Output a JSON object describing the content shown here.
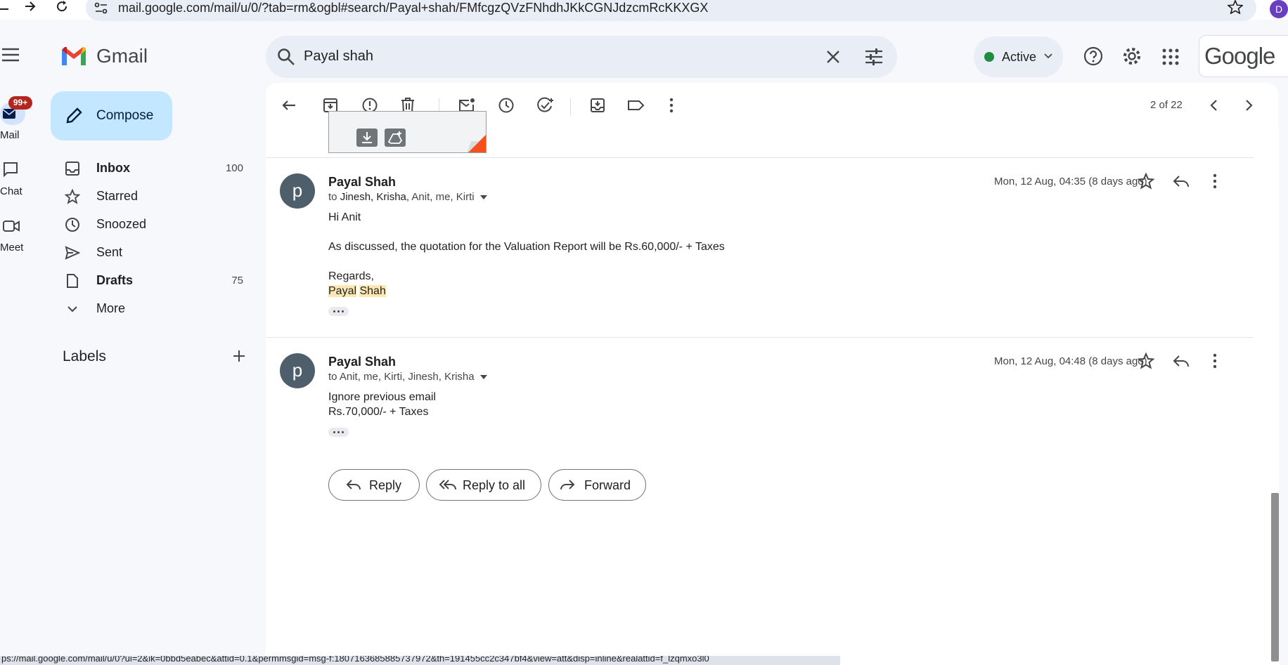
{
  "browser": {
    "url": "mail.google.com/mail/u/0/?tab=rm&ogbl#search/Payal+shah/FMfcgzQVzFNhdhJKkCGNJdzcmRcKKXGX",
    "profile_initial": "D",
    "status_url": "ps://mail.google.com/mail/u/0?ui=2&ik=0bbd5eabec&attid=0.1&permmsgid=msg-f:1807163685885737972&th=191455cc2c347bf4&view=att&disp=inline&realattid=f_lzqmxo3l0"
  },
  "rail": {
    "mail_label": "Mail",
    "mail_badge": "99+",
    "chat_label": "Chat",
    "meet_label": "Meet"
  },
  "app": {
    "name": "Gmail",
    "compose_label": "Compose",
    "labels_heading": "Labels",
    "brand_colors": {
      "red": "#ea4335",
      "blue": "#4285f4",
      "green": "#34a853",
      "yellow": "#fbbc04"
    }
  },
  "nav": [
    {
      "label": "Inbox",
      "count": "100",
      "icon": "inbox-icon",
      "bold": true
    },
    {
      "label": "Starred",
      "count": "",
      "icon": "star-icon",
      "bold": false
    },
    {
      "label": "Snoozed",
      "count": "",
      "icon": "clock-icon",
      "bold": false
    },
    {
      "label": "Sent",
      "count": "",
      "icon": "send-icon",
      "bold": false
    },
    {
      "label": "Drafts",
      "count": "75",
      "icon": "draft-icon",
      "bold": true
    },
    {
      "label": "More",
      "count": "",
      "icon": "chevron-down-icon",
      "bold": false
    }
  ],
  "search": {
    "query": "Payal shah"
  },
  "header": {
    "status": "Active",
    "status_color": "#1e8e3e",
    "google_word": "Google"
  },
  "toolbar": {
    "pager": "2 of 22"
  },
  "messages": [
    {
      "sender": "Payal Shah",
      "avatar": "p",
      "to_prefix": "to ",
      "recipients_bold": "Jinesh, Krisha",
      "recipients_rest": ", Anit, me, Kirti",
      "date": "Mon, 12 Aug, 04:35 (8 days ago)",
      "body": [
        "Hi Anit",
        "As discussed, the quotation for the Valuation Report will be Rs.60,000/- + Taxes",
        "Regards,"
      ],
      "signature_first": "Payal",
      "signature_last": "Shah"
    },
    {
      "sender": "Payal Shah",
      "avatar": "p",
      "to_prefix": "to ",
      "recipients_bold": "",
      "recipients_rest": "Anit, me, Kirti, Jinesh, Krisha",
      "date": "Mon, 12 Aug, 04:48 (8 days ago)",
      "body": [
        "Ignore previous email",
        "Rs.70,000/- + Taxes"
      ]
    }
  ],
  "actions": {
    "reply": "Reply",
    "reply_all": "Reply to all",
    "forward": "Forward"
  }
}
